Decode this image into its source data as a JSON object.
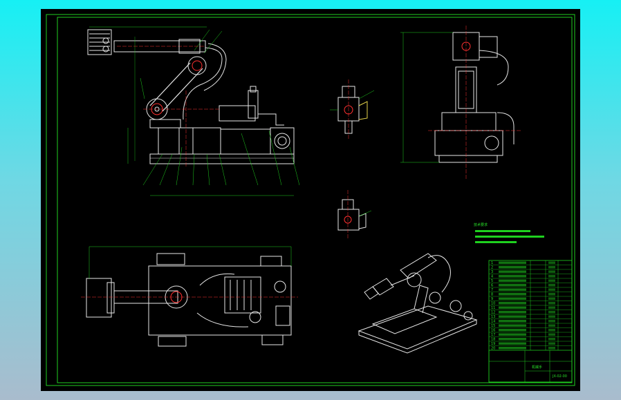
{
  "colors": {
    "background_top": "#16f0f4",
    "background_bottom": "#a9bccd",
    "sheet": "#000000",
    "frame": "#1fd11f",
    "outline": "#e8e8e8",
    "centerline": "#ff3030",
    "accent": "#e6d44a"
  },
  "title_block": {
    "drawing_title": "机械手",
    "drawing_number": "JX-02-00",
    "row_labels": [
      "1",
      "2",
      "3",
      "4",
      "5",
      "6",
      "7",
      "8",
      "9",
      "10",
      "11",
      "12",
      "13",
      "14",
      "15",
      "16",
      "17",
      "18",
      "19",
      "20"
    ]
  },
  "views": [
    "front-elevation",
    "side-elevation",
    "top-plan",
    "isometric-view",
    "detail-a",
    "detail-b"
  ],
  "notes_label": "技术要求"
}
